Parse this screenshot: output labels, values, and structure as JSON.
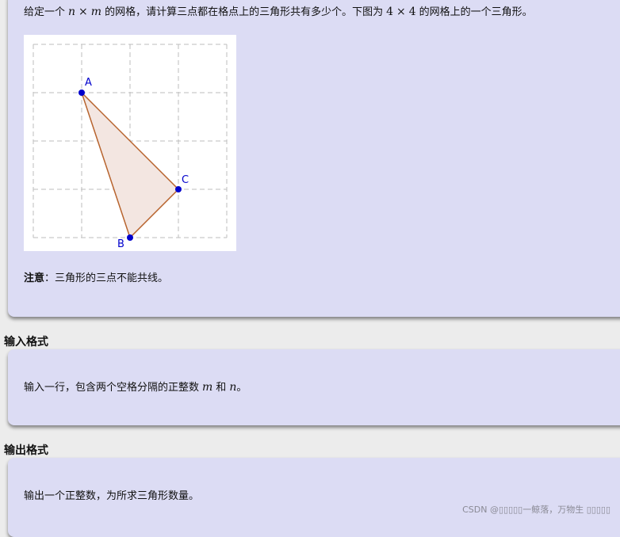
{
  "problem": {
    "intro": {
      "t1": "给定一个",
      "n": "n",
      "times": "×",
      "m": "m",
      "t2": "的网格，请计算三点都在格点上的三角形共有多少个。下图为",
      "four_a": "4",
      "times2": "×",
      "four_b": "4",
      "t3": "的网格上的一个三角形。"
    },
    "figure": {
      "point_a": "A",
      "point_b": "B",
      "point_c": "C",
      "point_color": "#0000cc",
      "edge_color": "#b8642e",
      "fill_color": "#f3e6e1"
    },
    "note": {
      "label": "注意",
      "colon": "：",
      "text": "三角形的三点不能共线。"
    }
  },
  "input_section": {
    "title": "输入格式",
    "t1": "输入一行，包含两个空格分隔的正整数",
    "m": "m",
    "and": "和",
    "n": "n",
    "end": "。"
  },
  "output_section": {
    "title": "输出格式",
    "text": "输出一个正整数，为所求三角形数量。"
  },
  "watermark": "CSDN @▯▯▯▯▯一鲸落，万物生 ▯▯▯▯▯"
}
